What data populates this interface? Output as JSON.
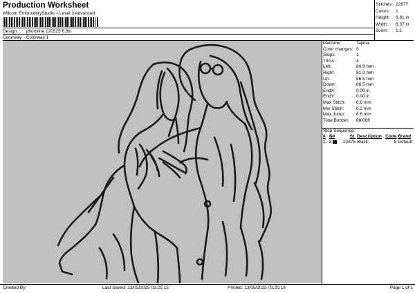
{
  "header": {
    "title": "Production Worksheet",
    "subtitle": "Wilcom EmbroideryStudio – Level 3 Advanced",
    "design_label": "Design:",
    "design_value": "photoline 120525 6,8in",
    "colorway_label": "Colorway:",
    "colorway_value": "Colorway 1"
  },
  "stats": [
    {
      "label": "Stitches:",
      "value": "22877"
    },
    {
      "label": "Colors:",
      "value": "1"
    },
    {
      "label": "Height:",
      "value": "6.81 in"
    },
    {
      "label": "Width:",
      "value": "6.37 in"
    },
    {
      "label": "Zoom:",
      "value": "1:1"
    }
  ],
  "machine": [
    {
      "label": "Machine:",
      "value": "Tajima"
    },
    {
      "label": "Color changes:",
      "value": "0"
    },
    {
      "label": "Stops:",
      "value": "1"
    },
    {
      "label": "Trims:",
      "value": "4"
    },
    {
      "label": "Left:",
      "value": "80.9 mm"
    },
    {
      "label": "Right:",
      "value": "81.0 mm"
    },
    {
      "label": "Up:",
      "value": "86.5 mm"
    },
    {
      "label": "Down:",
      "value": "86.5 mm"
    },
    {
      "label": "EndX:",
      "value": "0.00 in"
    },
    {
      "label": "EndY:",
      "value": "0.00 in"
    },
    {
      "label": "Max Stitch:",
      "value": "6.6 mm"
    },
    {
      "label": "Min Stitch:",
      "value": "0.2 mm"
    },
    {
      "label": "Max Jump:",
      "value": "6.6 mm"
    },
    {
      "label": "Total Bobbin:",
      "value": "88.06ft"
    }
  ],
  "stop_sequence": {
    "title": "Stop Sequence:",
    "headers": {
      "num": "#",
      "n": "N#",
      "st": "St.",
      "description": "Description",
      "code": "Code",
      "brand": "Brand"
    },
    "rows": [
      {
        "num": "1.",
        "n": "8",
        "st": "22875",
        "description": "Black",
        "code": "8",
        "brand": "Default",
        "color": "#000000"
      }
    ]
  },
  "footer": {
    "created": "Created By:",
    "last_saved": "Last Saved: 13/05/2025 03.20.15",
    "printed": "Printed: 13/05/2025 03.20.18",
    "page": "Page 1 of 1"
  },
  "colors": {
    "canvas_bg": "#c0c0c0",
    "stitch": "#1a1a1a"
  }
}
